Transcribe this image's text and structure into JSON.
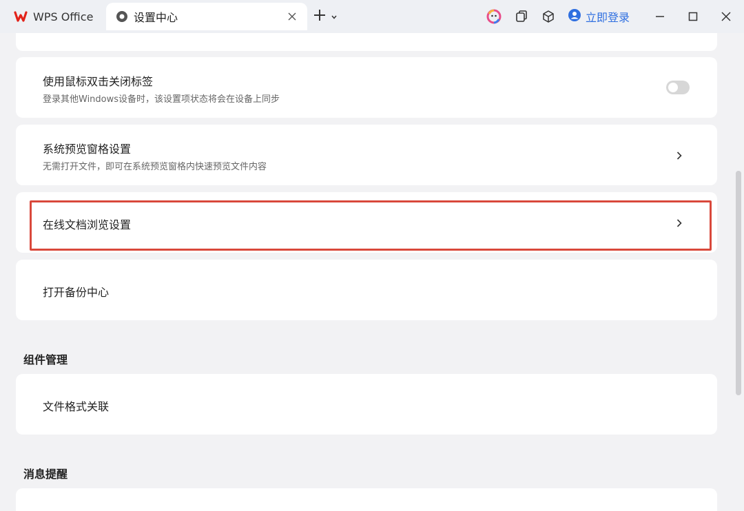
{
  "titlebar": {
    "app_tab_label": "WPS Office",
    "active_tab_label": "设置中心",
    "login_label": "立即登录"
  },
  "settings": {
    "items": [
      {
        "title": "使用鼠标双击关闭标签",
        "desc": "登录其他Windows设备时，该设置项状态将会在设备上同步",
        "control": "toggle",
        "toggle_on": false
      },
      {
        "title": "系统预览窗格设置",
        "desc": "无需打开文件，即可在系统预览窗格内快速预览文件内容",
        "control": "chevron"
      },
      {
        "title": "在线文档浏览设置",
        "control": "chevron",
        "highlighted": true
      },
      {
        "title": "打开备份中心"
      }
    ],
    "sections": [
      {
        "title": "组件管理",
        "items": [
          {
            "title": "文件格式关联"
          }
        ]
      },
      {
        "title": "消息提醒"
      }
    ]
  },
  "colors": {
    "accent": "#2f6fe0",
    "highlight_border": "#d9483b",
    "wps_red": "#e2231a"
  },
  "icons": [
    "wps-logo-icon",
    "gear-icon",
    "close-icon",
    "plus-icon",
    "chevron-down-icon",
    "ai-assistant-icon",
    "window-restore-icon",
    "cube-icon",
    "user-avatar-icon",
    "minimize-icon",
    "maximize-icon",
    "close-window-icon",
    "chevron-right-icon"
  ]
}
